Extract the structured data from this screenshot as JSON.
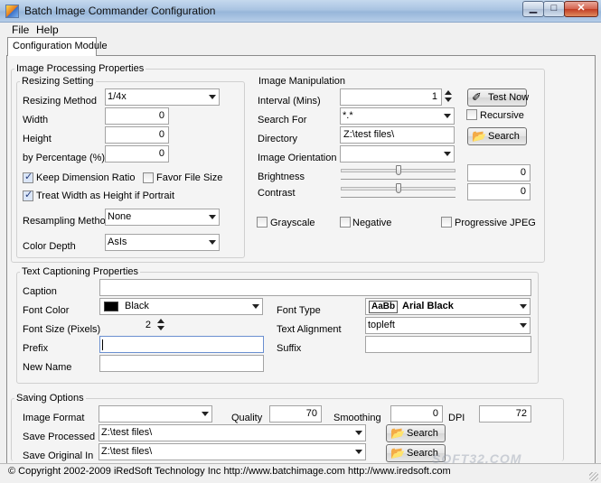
{
  "window": {
    "title": "Batch Image Commander Configuration",
    "minimize": "▁",
    "maximize": "□",
    "close": "✕"
  },
  "menu": {
    "file": "File",
    "help": "Help"
  },
  "tab": {
    "label": "Configuration Module"
  },
  "image_processing": {
    "title": "Image Processing Properties",
    "resizing": {
      "title": "Resizing Setting",
      "method_label": "Resizing Method",
      "method_value": "1/4x",
      "width_label": "Width",
      "width_value": "0",
      "height_label": "Height",
      "height_value": "0",
      "percentage_label": "by Percentage (%)",
      "percentage_value": "0",
      "keep_ratio_label": "Keep Dimension Ratio",
      "keep_ratio_checked": true,
      "favor_size_label": "Favor File Size",
      "favor_size_checked": false,
      "treat_width_label": "Treat Width as Height if Portrait",
      "treat_width_checked": true,
      "resampling_label": "Resampling Method",
      "resampling_value": "None",
      "color_depth_label": "Color Depth",
      "color_depth_value": "AsIs"
    },
    "manipulation": {
      "title": "Image Manipulation",
      "interval_label": "Interval (Mins)",
      "interval_value": "1",
      "test_now_label": "Test Now",
      "search_for_label": "Search For",
      "search_for_value": "*.*",
      "recursive_label": "Recursive",
      "recursive_checked": false,
      "directory_label": "Directory",
      "directory_value": "Z:\\test files\\",
      "search_label": "Search",
      "orientation_label": "Image Orientation",
      "orientation_value": "",
      "brightness_label": "Brightness",
      "brightness_value": "0",
      "brightness_level": 0.5,
      "contrast_label": "Contrast",
      "contrast_value": "0",
      "contrast_level": 0.5,
      "grayscale_label": "Grayscale",
      "negative_label": "Negative",
      "progressive_label": "Progressive JPEG"
    }
  },
  "captioning": {
    "title": "Text Captioning Properties",
    "caption_label": "Caption",
    "caption_value": "",
    "font_color_label": "Font Color",
    "font_color_value": "Black",
    "font_color_hex": "#000000",
    "font_type_label": "Font Type",
    "font_type_sample": "AaBb",
    "font_type_value": "Arial Black",
    "font_size_label": "Font Size (Pixels)",
    "font_size_value": "2",
    "alignment_label": "Text Alignment",
    "alignment_value": "topleft",
    "prefix_label": "Prefix",
    "prefix_value": "",
    "suffix_label": "Suffix",
    "suffix_value": "",
    "new_name_label": "New Name",
    "new_name_value": ""
  },
  "saving": {
    "title": "Saving Options",
    "format_label": "Image Format",
    "format_value": "",
    "quality_label": "Quality",
    "quality_value": "70",
    "smoothing_label": "Smoothing",
    "smoothing_value": "0",
    "dpi_label": "DPI",
    "dpi_value": "72",
    "processed_label": "Save Processed In",
    "processed_value": "Z:\\test files\\",
    "original_label": "Save Original In",
    "original_value": "Z:\\test files\\",
    "search_label": "Search"
  },
  "status": {
    "text": "© Copyright 2002-2009 iRedSoft Technology Inc http://www.batchimage.com http://www.iredsoft.com"
  },
  "watermark": "SOFT32.COM"
}
